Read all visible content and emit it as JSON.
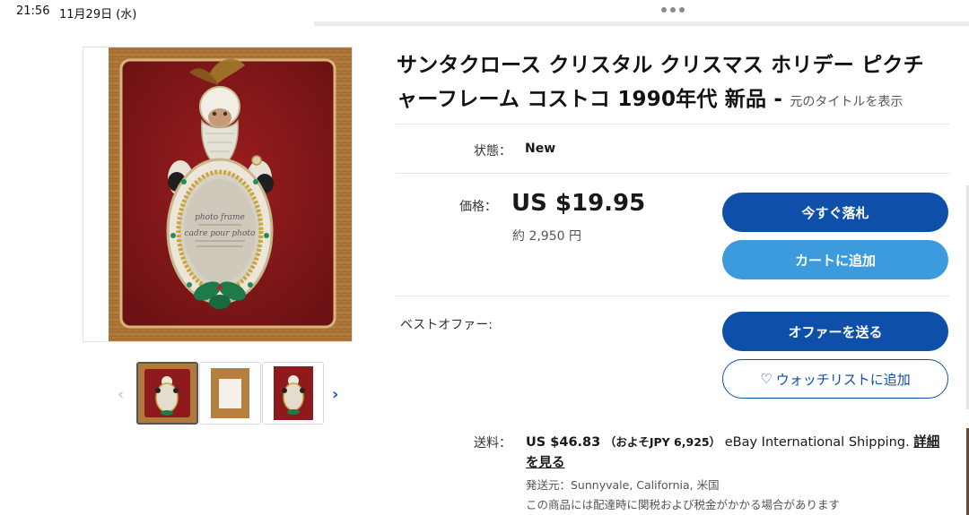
{
  "status_bar": {
    "time": "21:56",
    "date": "11月29日 (水)"
  },
  "listing": {
    "title": "サンタクロース クリスタル クリスマス ホリデー ピクチャーフレーム コストコ 1990年代 新品 -",
    "show_original_title": "元のタイトルを表示"
  },
  "condition": {
    "label": "状態：",
    "value": "New"
  },
  "price": {
    "label": "価格：",
    "value": "US $19.95",
    "approx_jpy": "約 2,950 円"
  },
  "buttons": {
    "buy_now": "今すぐ落札",
    "add_to_cart": "カートに追加",
    "send_offer": "オファーを送る",
    "add_to_watchlist": "ウォッチリストに追加"
  },
  "best_offer": {
    "label": "ベストオファー:"
  },
  "shipping": {
    "label": "送料：",
    "amount": "US $46.83",
    "approx": "（およそJPY 6,925）",
    "service": "eBay International Shipping.",
    "details_link": "詳細を見る",
    "ships_from": "発送元：Sunnyvale, California, 米国",
    "tax_note": "この商品には配達時に関税および税金がかかる場合があります"
  },
  "product_image_text": {
    "line1": "photo frame",
    "line2": "cadre pour photo"
  },
  "colors": {
    "primary_button": "#0e4fa9",
    "secondary_button": "#3c9bdc",
    "link": "#1a5ec4"
  },
  "icons": {
    "thumb_prev": "chevron-left-icon",
    "thumb_next": "chevron-right-icon",
    "watchlist": "heart-icon"
  }
}
